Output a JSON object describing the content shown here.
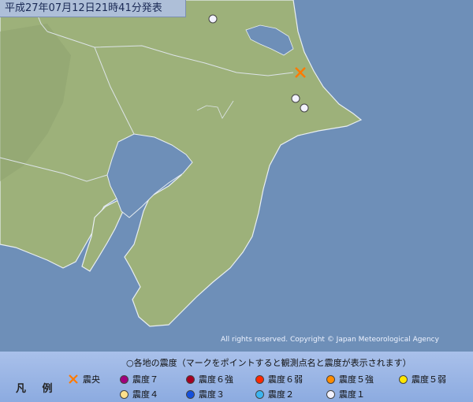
{
  "header": {
    "timestamp": "平成27年07月12日21時41分発表"
  },
  "copyright": "All rights reserved. Copyright © Japan Meteorological Agency",
  "legend": {
    "title": "凡 例",
    "note": "○各地の震度（マークをポイントすると観測点名と震度が表示されます）",
    "epicenter_label": "震央",
    "items": [
      {
        "label": "震度７",
        "color": "#a0007d"
      },
      {
        "label": "震度６強",
        "color": "#a50021"
      },
      {
        "label": "震度６弱",
        "color": "#ff2800"
      },
      {
        "label": "震度５強",
        "color": "#ff8c00"
      },
      {
        "label": "震度５弱",
        "color": "#ffe600"
      },
      {
        "label": "震度４",
        "color": "#ffe08c"
      },
      {
        "label": "震度３",
        "color": "#1450dc"
      },
      {
        "label": "震度２",
        "color": "#3cb4f0"
      },
      {
        "label": "震度１",
        "color": "#f2f2ff"
      }
    ]
  },
  "map": {
    "epicenter_icon": "x-mark-icon",
    "stations": [
      {
        "intensity": "震度１"
      },
      {
        "intensity": "震度１"
      },
      {
        "intensity": "震度１"
      }
    ]
  }
}
